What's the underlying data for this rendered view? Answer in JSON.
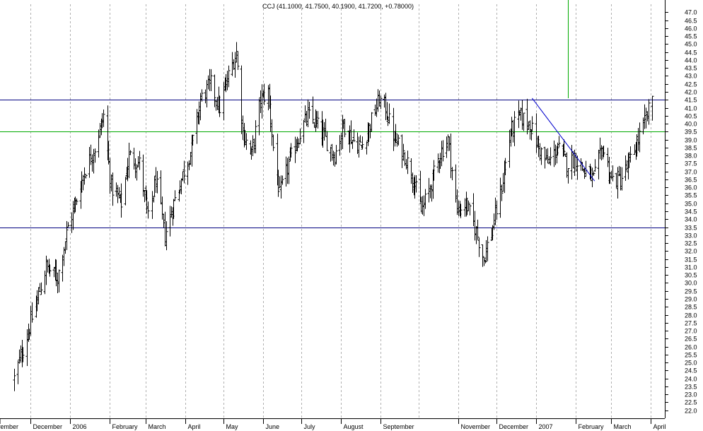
{
  "chart_data": {
    "type": "bar",
    "style": "ohlc",
    "title": "CCJ (41.1000, 41.7500, 40.1900, 41.7200, +0.78000)",
    "xlabel": "",
    "ylabel": "",
    "ylim": [
      21.5,
      47.5
    ],
    "y_tick_step": 0.5,
    "grid": "vertical dashed",
    "y_axis_side": "right",
    "x_tick_labels": [
      "vember",
      "December",
      "2006",
      "February",
      "March",
      "April",
      "May",
      "June",
      "July",
      "August",
      "September",
      "November",
      "December",
      "2007",
      "February",
      "March",
      "April"
    ],
    "horizontal_lines": [
      {
        "price": 41.5,
        "color": "#000080"
      },
      {
        "price": 39.5,
        "color": "#00aa00"
      },
      {
        "price": 33.5,
        "color": "#000080"
      }
    ],
    "trendline": {
      "from": {
        "date": "2006-12-29",
        "price": 41.6
      },
      "to": {
        "date": "2007-02-16",
        "price": 36.4
      },
      "color": "#0000cc"
    },
    "vertical_marker": {
      "date": "2007-01-26",
      "from_price": 41.6,
      "to_price": 47.5,
      "color": "#00aa00"
    },
    "last_bar": {
      "open": 41.1,
      "high": 41.75,
      "low": 40.19,
      "close": 41.72,
      "change": 0.78
    },
    "keypoints": [
      {
        "date": "2005-11-18",
        "price": 24.0
      },
      {
        "date": "2005-12-01",
        "price": 27.5
      },
      {
        "date": "2005-12-13",
        "price": 31.0
      },
      {
        "date": "2005-12-22",
        "price": 30.3
      },
      {
        "date": "2005-12-30",
        "price": 33.5
      },
      {
        "date": "2006-01-05",
        "price": 35.0
      },
      {
        "date": "2006-01-12",
        "price": 37.0
      },
      {
        "date": "2006-01-20",
        "price": 38.5
      },
      {
        "date": "2006-01-27",
        "price": 40.5
      },
      {
        "date": "2006-02-02",
        "price": 36.0
      },
      {
        "date": "2006-02-10",
        "price": 35.0
      },
      {
        "date": "2006-02-16",
        "price": 38.0
      },
      {
        "date": "2006-02-24",
        "price": 37.5
      },
      {
        "date": "2006-03-03",
        "price": 34.0
      },
      {
        "date": "2006-03-09",
        "price": 36.5
      },
      {
        "date": "2006-03-16",
        "price": 33.0
      },
      {
        "date": "2006-03-23",
        "price": 35.0
      },
      {
        "date": "2006-03-30",
        "price": 36.8
      },
      {
        "date": "2006-04-06",
        "price": 38.5
      },
      {
        "date": "2006-04-13",
        "price": 41.5
      },
      {
        "date": "2006-04-21",
        "price": 42.5
      },
      {
        "date": "2006-04-28",
        "price": 41.0
      },
      {
        "date": "2006-05-05",
        "price": 43.0
      },
      {
        "date": "2006-05-11",
        "price": 44.5
      },
      {
        "date": "2006-05-16",
        "price": 39.5
      },
      {
        "date": "2006-05-23",
        "price": 38.0
      },
      {
        "date": "2006-05-30",
        "price": 41.5
      },
      {
        "date": "2006-06-05",
        "price": 42.0
      },
      {
        "date": "2006-06-09",
        "price": 38.5
      },
      {
        "date": "2006-06-14",
        "price": 35.5
      },
      {
        "date": "2006-06-21",
        "price": 37.5
      },
      {
        "date": "2006-06-28",
        "price": 39.0
      },
      {
        "date": "2006-07-06",
        "price": 40.5
      },
      {
        "date": "2006-07-13",
        "price": 40.0
      },
      {
        "date": "2006-07-20",
        "price": 39.0
      },
      {
        "date": "2006-07-27",
        "price": 38.0
      },
      {
        "date": "2006-08-03",
        "price": 40.0
      },
      {
        "date": "2006-08-10",
        "price": 39.0
      },
      {
        "date": "2006-08-17",
        "price": 38.5
      },
      {
        "date": "2006-08-24",
        "price": 40.0
      },
      {
        "date": "2006-08-31",
        "price": 41.5
      },
      {
        "date": "2006-09-05",
        "price": 41.0
      },
      {
        "date": "2006-09-12",
        "price": 39.0
      },
      {
        "date": "2006-09-20",
        "price": 38.0
      },
      {
        "date": "2006-09-27",
        "price": 36.5
      },
      {
        "date": "2006-10-03",
        "price": 34.5
      },
      {
        "date": "2006-10-10",
        "price": 36.0
      },
      {
        "date": "2006-10-17",
        "price": 38.0
      },
      {
        "date": "2006-10-24",
        "price": 39.0
      },
      {
        "date": "2006-10-31",
        "price": 34.5
      },
      {
        "date": "2006-11-07",
        "price": 35.0
      },
      {
        "date": "2006-11-14",
        "price": 33.5
      },
      {
        "date": "2006-11-21",
        "price": 31.5
      },
      {
        "date": "2006-11-28",
        "price": 33.5
      },
      {
        "date": "2006-12-05",
        "price": 36.0
      },
      {
        "date": "2006-12-12",
        "price": 39.5
      },
      {
        "date": "2006-12-19",
        "price": 40.5
      },
      {
        "date": "2006-12-27",
        "price": 40.0
      },
      {
        "date": "2007-01-03",
        "price": 38.5
      },
      {
        "date": "2007-01-10",
        "price": 37.5
      },
      {
        "date": "2007-01-18",
        "price": 38.5
      },
      {
        "date": "2007-01-25",
        "price": 37.5
      },
      {
        "date": "2007-02-01",
        "price": 37.8
      },
      {
        "date": "2007-02-08",
        "price": 37.0
      },
      {
        "date": "2007-02-15",
        "price": 36.5
      },
      {
        "date": "2007-02-22",
        "price": 38.5
      },
      {
        "date": "2007-03-01",
        "price": 36.5
      },
      {
        "date": "2007-03-08",
        "price": 36.5
      },
      {
        "date": "2007-03-15",
        "price": 37.5
      },
      {
        "date": "2007-03-22",
        "price": 39.0
      },
      {
        "date": "2007-03-29",
        "price": 40.5
      },
      {
        "date": "2007-04-02",
        "price": 41.72
      }
    ]
  }
}
